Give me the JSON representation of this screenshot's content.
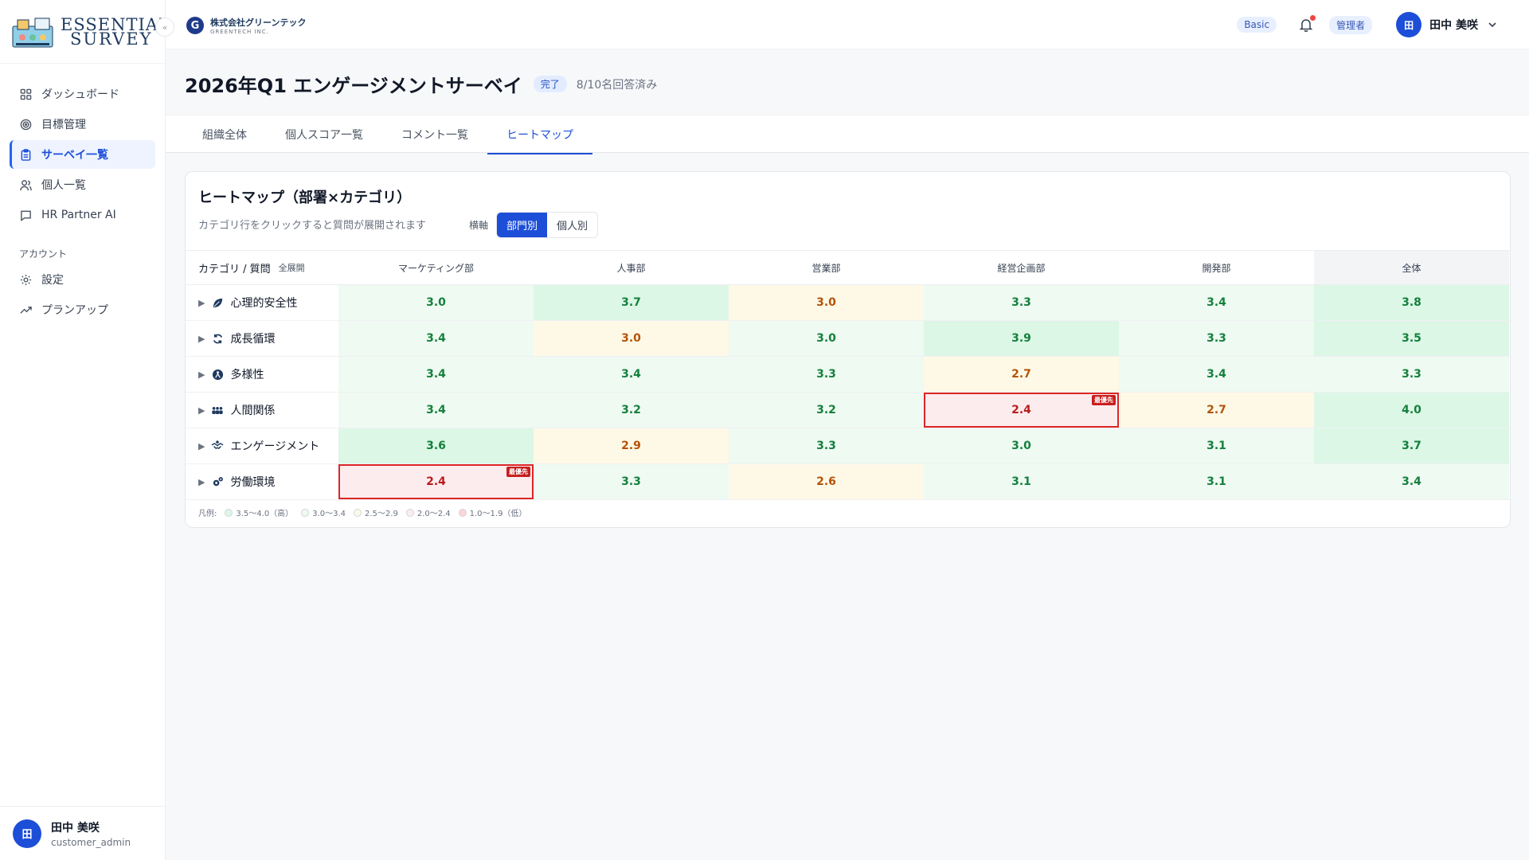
{
  "app": {
    "logo_line1": "ESSENTIAL",
    "logo_line2": "SURVEY",
    "collapse_glyph": "«"
  },
  "sidebar": {
    "items": [
      {
        "label": "ダッシュボード",
        "icon": "dashboard-icon"
      },
      {
        "label": "目標管理",
        "icon": "target-icon"
      },
      {
        "label": "サーベイ一覧",
        "icon": "clipboard-icon",
        "active": true
      },
      {
        "label": "個人一覧",
        "icon": "users-icon"
      },
      {
        "label": "HR Partner AI",
        "icon": "chat-icon"
      }
    ],
    "section_account": "アカウント",
    "account_items": [
      {
        "label": "設定",
        "icon": "gear-icon"
      },
      {
        "label": "プランアップ",
        "icon": "trend-up-icon"
      }
    ],
    "user": {
      "avatar": "田",
      "name": "田中 美咲",
      "role": "customer_admin"
    }
  },
  "topbar": {
    "company_initial": "G",
    "company_name": "株式会社グリーンテック",
    "company_sub": "GREENTECH INC.",
    "plan_badge": "Basic",
    "role_badge": "管理者",
    "user_avatar": "田",
    "user_name": "田中 美咲"
  },
  "page": {
    "title": "2026年Q1 エンゲージメントサーベイ",
    "status": "完了",
    "responses": "8/10名回答済み",
    "tabs": [
      "組織全体",
      "個人スコア一覧",
      "コメント一覧",
      "ヒートマップ"
    ],
    "active_tab": 3
  },
  "heatmap": {
    "title": "ヒートマップ（部署×カテゴリ）",
    "subtitle": "カテゴリ行をクリックすると質問が展開されます",
    "axis_label": "横軸",
    "axis_options": [
      "部門別",
      "個人別"
    ],
    "corner_label": "カテゴリ / 質問",
    "expand_all": "全展開",
    "columns": [
      "マーケティング部",
      "人事部",
      "営業部",
      "経営企画部",
      "開発部",
      "全体"
    ],
    "priority_label": "最優先",
    "rows": [
      {
        "category": "心理的安全性",
        "icon": "leaf-icon",
        "values": [
          "3.0",
          "3.7",
          "3.0",
          "3.3",
          "3.4",
          "3.8"
        ],
        "levels": [
          2,
          1,
          3,
          2,
          2,
          1
        ]
      },
      {
        "category": "成長循環",
        "icon": "cycle-icon",
        "values": [
          "3.4",
          "3.0",
          "3.0",
          "3.9",
          "3.3",
          "3.5"
        ],
        "levels": [
          2,
          3,
          2,
          1,
          2,
          1
        ]
      },
      {
        "category": "多様性",
        "icon": "diversity-icon",
        "values": [
          "3.4",
          "3.4",
          "3.3",
          "2.7",
          "3.4",
          "3.3"
        ],
        "levels": [
          2,
          2,
          2,
          3,
          2,
          2
        ]
      },
      {
        "category": "人間関係",
        "icon": "people-icon",
        "values": [
          "3.4",
          "3.2",
          "3.2",
          "2.4",
          "2.7",
          "4.0"
        ],
        "levels": [
          2,
          2,
          2,
          4,
          3,
          1
        ]
      },
      {
        "category": "エンゲージメント",
        "icon": "handshake-icon",
        "values": [
          "3.6",
          "2.9",
          "3.3",
          "3.0",
          "3.1",
          "3.7"
        ],
        "levels": [
          1,
          3,
          2,
          2,
          2,
          1
        ]
      },
      {
        "category": "労働環境",
        "icon": "gears-icon",
        "values": [
          "2.4",
          "3.3",
          "2.6",
          "3.1",
          "3.1",
          "3.4"
        ],
        "levels": [
          4,
          2,
          3,
          2,
          2,
          2
        ]
      }
    ],
    "legend_label": "凡例:",
    "legend": [
      {
        "label": "3.5〜4.0（高）",
        "color": "#dcf7e6"
      },
      {
        "label": "3.0〜3.4",
        "color": "#eefaf2"
      },
      {
        "label": "2.5〜2.9",
        "color": "#fef9e7"
      },
      {
        "label": "2.0〜2.4",
        "color": "#fdecee"
      },
      {
        "label": "1.0〜1.9（低）",
        "color": "#fbd5d8"
      }
    ]
  }
}
